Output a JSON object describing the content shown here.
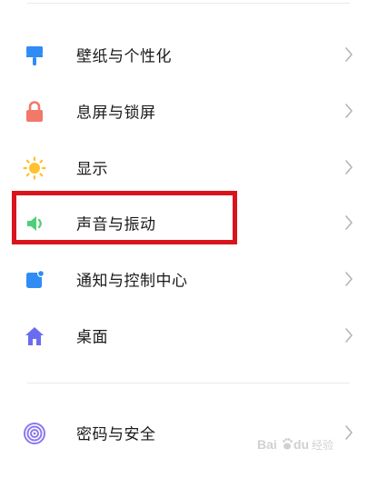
{
  "settings": {
    "items": [
      {
        "label": "壁纸与个性化",
        "icon": "brush-icon",
        "color": "#2f8cf5"
      },
      {
        "label": "息屏与锁屏",
        "icon": "lock-icon",
        "color": "#f2786a"
      },
      {
        "label": "显示",
        "icon": "sun-icon",
        "color": "#ffc12e"
      },
      {
        "label": "声音与振动",
        "icon": "speaker-icon",
        "color": "#4fce79"
      },
      {
        "label": "通知与控制中心",
        "icon": "notification-icon",
        "color": "#2f8cf5"
      },
      {
        "label": "桌面",
        "icon": "home-icon",
        "color": "#6a6cf0"
      },
      {
        "label": "密码与安全",
        "icon": "fingerprint-icon",
        "color": "#8b78f0"
      }
    ]
  },
  "annotation": {
    "highlighted_item": "声音与振动",
    "color": "#d9141c"
  },
  "watermark": {
    "text": "Bai du 经验",
    "icon": "baidu-paw-icon"
  }
}
